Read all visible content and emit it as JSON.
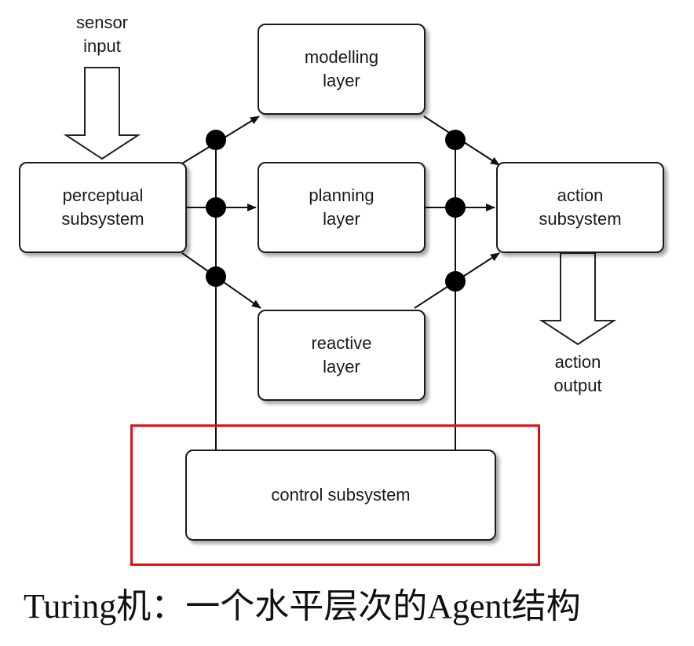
{
  "diagram": {
    "sensor_input": [
      "sensor",
      "input"
    ],
    "action_output": [
      "action",
      "output"
    ],
    "perceptual": [
      "perceptual",
      "subsystem"
    ],
    "modelling": [
      "modelling",
      "layer"
    ],
    "planning": [
      "planning",
      "layer"
    ],
    "reactive": [
      "reactive",
      "layer"
    ],
    "action": [
      "action",
      "subsystem"
    ],
    "control": "control subsystem",
    "highlight_color": "#e01010"
  },
  "caption": "Turing机：一个水平层次的Agent结构"
}
